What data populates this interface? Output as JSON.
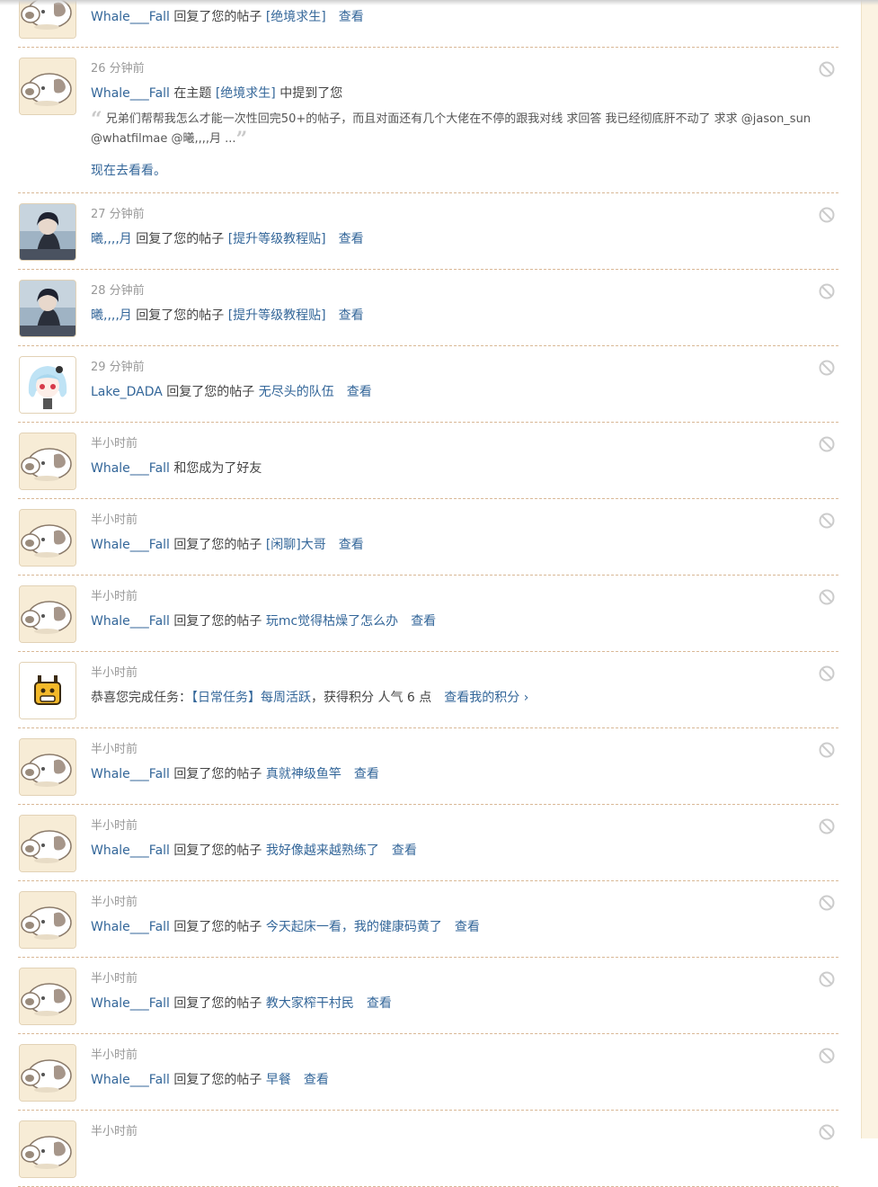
{
  "items": [
    {
      "avatar": "cow-avatar",
      "time": "",
      "user": "Whale___Fall",
      "action": "回复了您的帖子",
      "thread": "[绝境求生]",
      "view": "查看"
    },
    {
      "avatar": "cow-avatar",
      "time": "26 分钟前",
      "user": "Whale___Fall",
      "action_before": "在主题",
      "thread": "[绝境求生]",
      "action_after": "中提到了您",
      "quote_open": "“",
      "quote": "兄弟们帮帮我怎么才能一次性回完50+的帖子，而且对面还有几个大佬在不停的跟我对线 求回答 我已经彻底肝不动了 求求 @jason_sun @whatfilmae @曦,,,,月 ...",
      "quote_close": "”",
      "goto": "现在去看看。"
    },
    {
      "avatar": "anime-dark-avatar",
      "time": "27 分钟前",
      "user": "曦,,,,月",
      "action": "回复了您的帖子",
      "thread": "[提升等级教程贴]",
      "view": "查看"
    },
    {
      "avatar": "anime-dark-avatar",
      "time": "28 分钟前",
      "user": "曦,,,,月",
      "action": "回复了您的帖子",
      "thread": "[提升等级教程贴]",
      "view": "查看"
    },
    {
      "avatar": "anime-girl-avatar",
      "time": "29 分钟前",
      "user": "Lake_DADA",
      "action": "回复了您的帖子",
      "thread": "无尽头的队伍",
      "view": "查看"
    },
    {
      "avatar": "cow-avatar",
      "time": "半小时前",
      "user": "Whale___Fall",
      "action": "和您成为了好友"
    },
    {
      "avatar": "cow-avatar",
      "time": "半小时前",
      "user": "Whale___Fall",
      "action": "回复了您的帖子",
      "thread": "[闲聊]大哥",
      "view": "查看"
    },
    {
      "avatar": "cow-avatar",
      "time": "半小时前",
      "user": "Whale___Fall",
      "action": "回复了您的帖子",
      "thread": "玩mc觉得枯燥了怎么办",
      "view": "查看"
    },
    {
      "avatar": "giraffe-avatar",
      "time": "半小时前",
      "task_prefix": "恭喜您完成任务：",
      "task": "【日常任务】每周活跃",
      "task_suffix": "，获得积分 人气 6 点",
      "task_link": "查看我的积分 ›"
    },
    {
      "avatar": "cow-avatar",
      "time": "半小时前",
      "user": "Whale___Fall",
      "action": "回复了您的帖子",
      "thread": "真就神级鱼竿",
      "view": "查看"
    },
    {
      "avatar": "cow-avatar",
      "time": "半小时前",
      "user": "Whale___Fall",
      "action": "回复了您的帖子",
      "thread": "我好像越来越熟练了",
      "view": "查看"
    },
    {
      "avatar": "cow-avatar",
      "time": "半小时前",
      "user": "Whale___Fall",
      "action": "回复了您的帖子",
      "thread": "今天起床一看，我的健康码黄了",
      "view": "查看"
    },
    {
      "avatar": "cow-avatar",
      "time": "半小时前",
      "user": "Whale___Fall",
      "action": "回复了您的帖子",
      "thread": "教大家榨干村民",
      "view": "查看"
    },
    {
      "avatar": "cow-avatar",
      "time": "半小时前",
      "user": "Whale___Fall",
      "action": "回复了您的帖子",
      "thread": "早餐",
      "view": "查看"
    },
    {
      "avatar": "cow-avatar",
      "time": "半小时前"
    }
  ],
  "icons": {
    "ignore": "ban-icon"
  },
  "colors": {
    "link": "#336699",
    "time": "#999999",
    "divider": "#d9b896",
    "avatar_bg": "#f7ecd6",
    "gutter": "#fbf3e2"
  }
}
